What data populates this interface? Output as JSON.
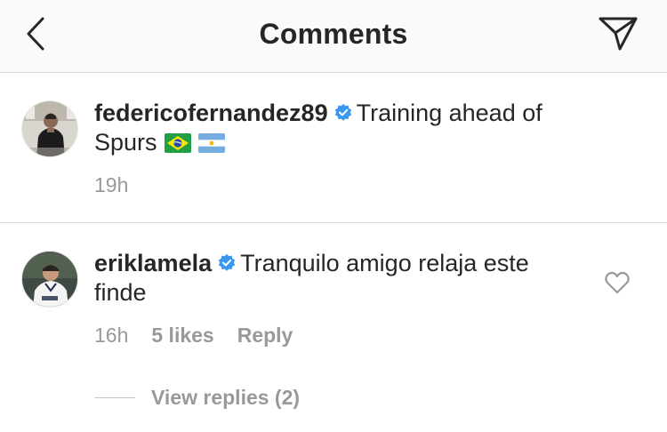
{
  "header": {
    "title": "Comments",
    "back_icon": "chevron-left-icon",
    "share_icon": "direct-send-icon"
  },
  "caption": {
    "username": "federicofernandez89",
    "verified": true,
    "text": "Training ahead of Spurs",
    "emoji": [
      "brazil-flag",
      "argentina-flag"
    ],
    "time": "19h"
  },
  "comment": {
    "username": "eriklamela",
    "verified": true,
    "text": "Tranquilo amigo relaja este finde",
    "time": "16h",
    "likes": "5 likes",
    "reply_label": "Reply",
    "view_replies": "View replies (2)",
    "like_icon": "heart-outline-icon"
  },
  "colors": {
    "text": "#262626",
    "muted": "#999999",
    "verified": "#3897f0",
    "divider": "#dbdbdb",
    "header_bg": "#fafafa"
  }
}
